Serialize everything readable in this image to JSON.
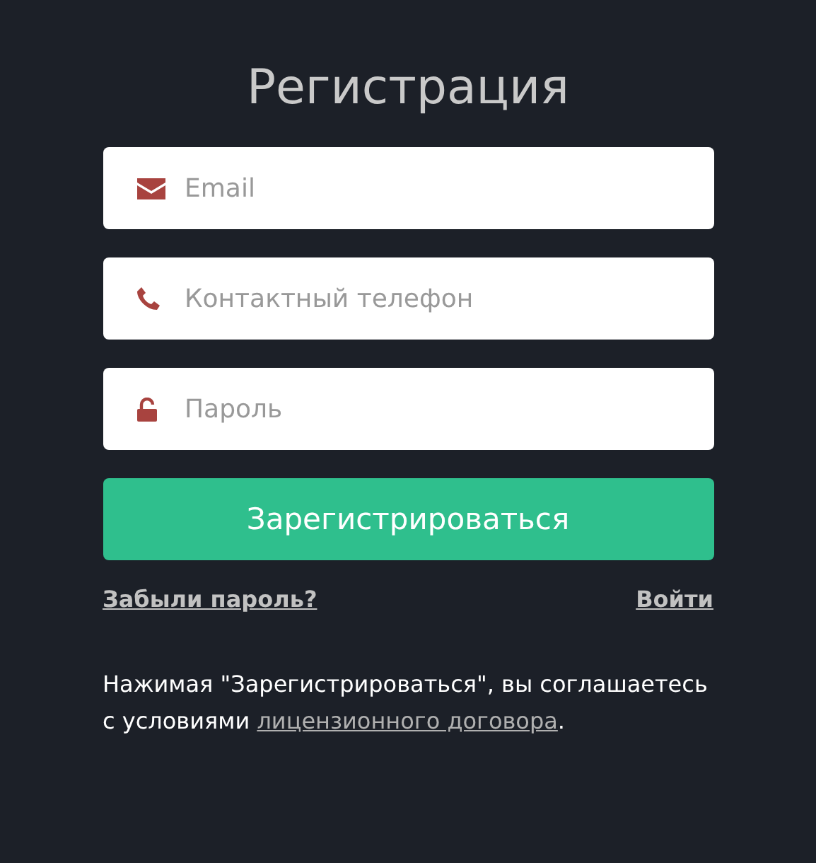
{
  "title": "Регистрация",
  "fields": [
    {
      "kind": "email",
      "placeholder": "Email"
    },
    {
      "kind": "phone",
      "placeholder": "Контактный телефон"
    },
    {
      "kind": "password",
      "placeholder": "Пароль"
    }
  ],
  "submit": "Зарегистрироваться",
  "links": {
    "forgot": "Забыли пароль?",
    "login": "Войти"
  },
  "terms": {
    "before": "Нажимая \"Зарегистрироваться\", вы соглашаетесь с условиями",
    "link": "лицензионного договора",
    "after": "."
  }
}
